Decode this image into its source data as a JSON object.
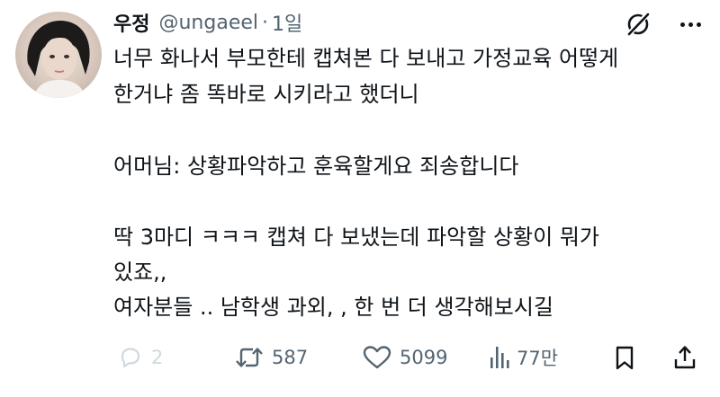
{
  "author": {
    "name": "우정",
    "handle": "@ungaeel",
    "separator": "·",
    "time": "1일"
  },
  "tweet": {
    "lines": [
      "너무 화나서 부모한테 캡쳐본 다 보내고 가정교육 어떻게",
      "한거냐 좀 똑바로 시키라고 했더니",
      "어머님: 상황파악하고 훈육할게요 죄송합니다",
      "딱 3마디 ㅋㅋㅋ 캡쳐 다 보냈는데 파악할 상황이 뭐가",
      "있죠,,",
      "여자분들 .. 남학생 과외, , 한 번 더 생각해보시길"
    ]
  },
  "actions": {
    "reply_count": "2",
    "retweet_count": "587",
    "like_count": "5099",
    "view_count": "77만"
  },
  "icons": {
    "reply": "reply-icon",
    "retweet": "retweet-icon",
    "like": "heart-icon",
    "views": "views-icon",
    "bookmark": "bookmark-icon",
    "share": "share-icon",
    "grok": "grok-icon",
    "more": "more-icon"
  },
  "colors": {
    "text": "#0f1419",
    "muted": "#536471",
    "reply_muted": "#cfd9de"
  }
}
